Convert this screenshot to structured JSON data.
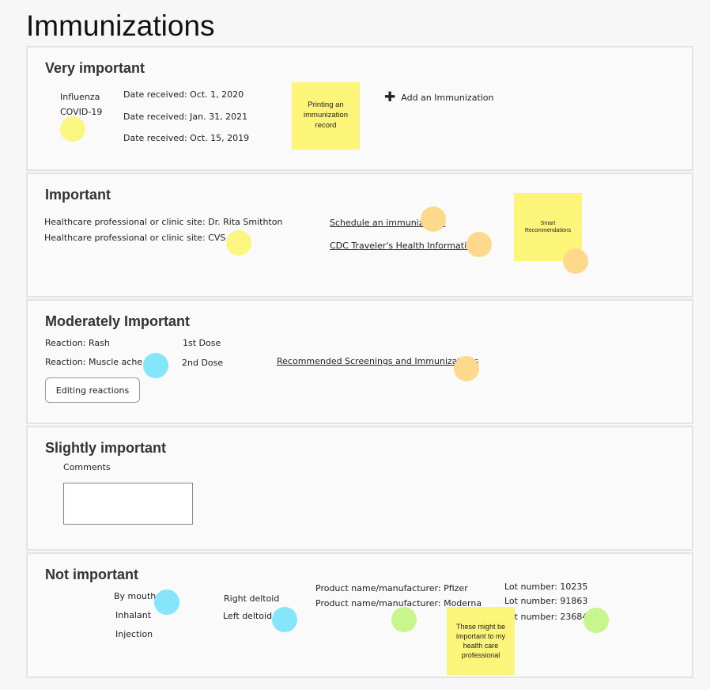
{
  "page": {
    "title": "Immunizations"
  },
  "very_important": {
    "title": "Very important",
    "vaccines": [
      "Influenza",
      "COVID-19"
    ],
    "dates": [
      "Date received: Oct. 1, 2020",
      "Date received: Jan. 31, 2021",
      "Date received: Oct. 15, 2019"
    ],
    "sticky": "Printing an immunization record",
    "add_label": "Add an Immunization"
  },
  "important": {
    "title": "Important",
    "providers": [
      "Healthcare professional or clinic site: Dr. Rita Smithton",
      "Healthcare professional or clinic site: CVS"
    ],
    "links": [
      "Schedule an immunization",
      "CDC Traveler's Health Information"
    ],
    "sticky": "Smart Recommendations"
  },
  "moderately_important": {
    "title": "Moderately Important",
    "reactions": [
      "Reaction: Rash",
      "Reaction: Muscle ache"
    ],
    "doses": [
      "1st Dose",
      "2nd Dose"
    ],
    "link": "Recommended Screenings and Immunizations",
    "button": "Editing reactions"
  },
  "slightly_important": {
    "title": "Slightly important",
    "comments_label": "Comments",
    "comments_value": ""
  },
  "not_important": {
    "title": "Not important",
    "routes": [
      "By mouth",
      "Inhalant",
      "Injection"
    ],
    "sites": [
      "Right deltoid",
      "Left deltoid"
    ],
    "products": [
      "Product name/manufacturer: Pfizer",
      "Product name/manufacturer: Moderna"
    ],
    "lots": [
      "Lot number: 10235",
      "Lot number: 91863",
      "Lot number: 23684"
    ],
    "sticky": "These might be important to my health care professional"
  },
  "colors": {
    "sticky": "#fdf57a",
    "dot_yellow": "#fbf67f",
    "dot_orange": "#fed98c",
    "dot_blue": "#84e5fb",
    "dot_green": "#c7f68d"
  }
}
